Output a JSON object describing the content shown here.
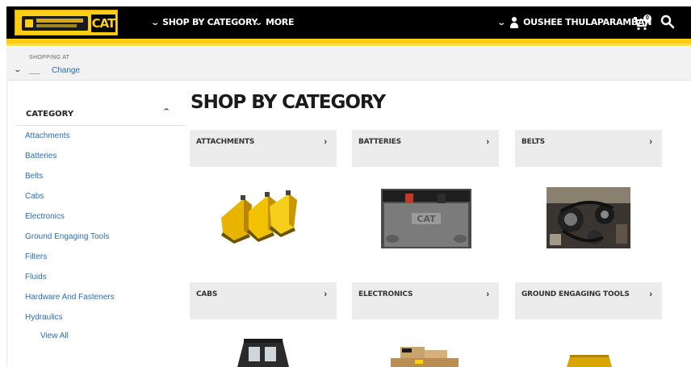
{
  "header": {
    "logo_text": "CAT",
    "nav": {
      "shop_by_category": "SHOP BY CATEGORY",
      "more": "MORE"
    },
    "user_name": "OUSHEE THULAPARAMBAN",
    "cart_count": "0",
    "brand_color": "#ffcd11"
  },
  "shopping_at": {
    "label": "SHOPPING AT",
    "change": "Change"
  },
  "sidebar": {
    "heading": "CATEGORY",
    "items": [
      "Attachments",
      "Batteries",
      "Belts",
      "Cabs",
      "Electronics",
      "Ground Engaging Tools",
      "Filters",
      "Fluids",
      "Hardware And Fasteners",
      "Hydraulics"
    ],
    "view_all": "View All",
    "link_color": "#2a6db5"
  },
  "main": {
    "title": "SHOP BY CATEGORY",
    "tiles": [
      {
        "label": "ATTACHMENTS",
        "image": "bucket-attachments"
      },
      {
        "label": "BATTERIES",
        "image": "cat-battery"
      },
      {
        "label": "BELTS",
        "image": "engine-belts"
      },
      {
        "label": "CABS",
        "image": "machine-cab"
      },
      {
        "label": "ELECTRONICS",
        "image": "electronics-boxes"
      },
      {
        "label": "GROUND ENGAGING TOOLS",
        "image": "ground-engaging-tool"
      }
    ]
  },
  "icons": {
    "chevron": "chevron-down-icon",
    "user": "user-icon",
    "cart": "cart-icon",
    "search": "search-icon"
  }
}
